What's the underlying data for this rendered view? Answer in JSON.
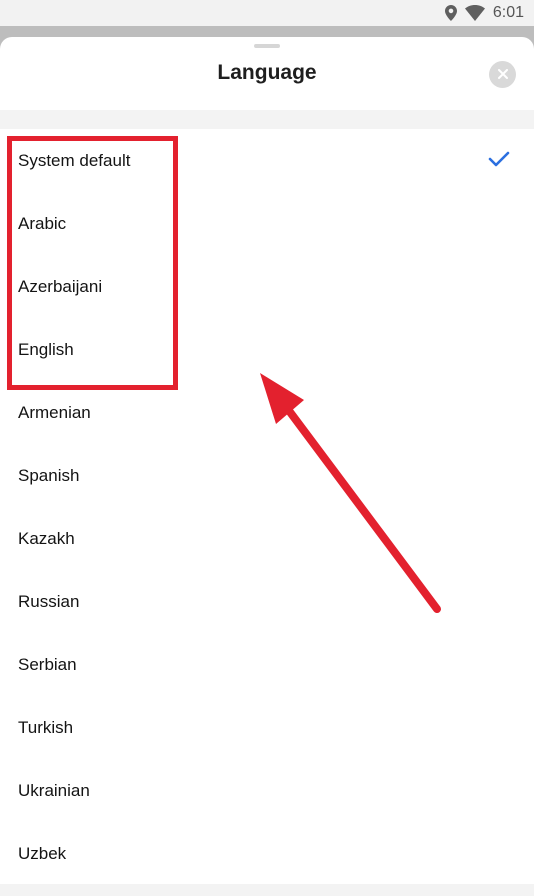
{
  "status_bar": {
    "time": "6:01",
    "icons": [
      "location-icon",
      "wifi-icon"
    ]
  },
  "sheet": {
    "title": "Language",
    "close_icon": "close-icon"
  },
  "languages": [
    {
      "label": "System default",
      "selected": true
    },
    {
      "label": "Arabic",
      "selected": false
    },
    {
      "label": "Azerbaijani",
      "selected": false
    },
    {
      "label": "English",
      "selected": false
    },
    {
      "label": "Armenian",
      "selected": false
    },
    {
      "label": "Spanish",
      "selected": false
    },
    {
      "label": "Kazakh",
      "selected": false
    },
    {
      "label": "Russian",
      "selected": false
    },
    {
      "label": "Serbian",
      "selected": false
    },
    {
      "label": "Turkish",
      "selected": false
    },
    {
      "label": "Ukrainian",
      "selected": false
    },
    {
      "label": "Uzbek",
      "selected": false
    }
  ],
  "colors": {
    "accent": "#2b6fe0",
    "annotation": "#e3212e"
  }
}
